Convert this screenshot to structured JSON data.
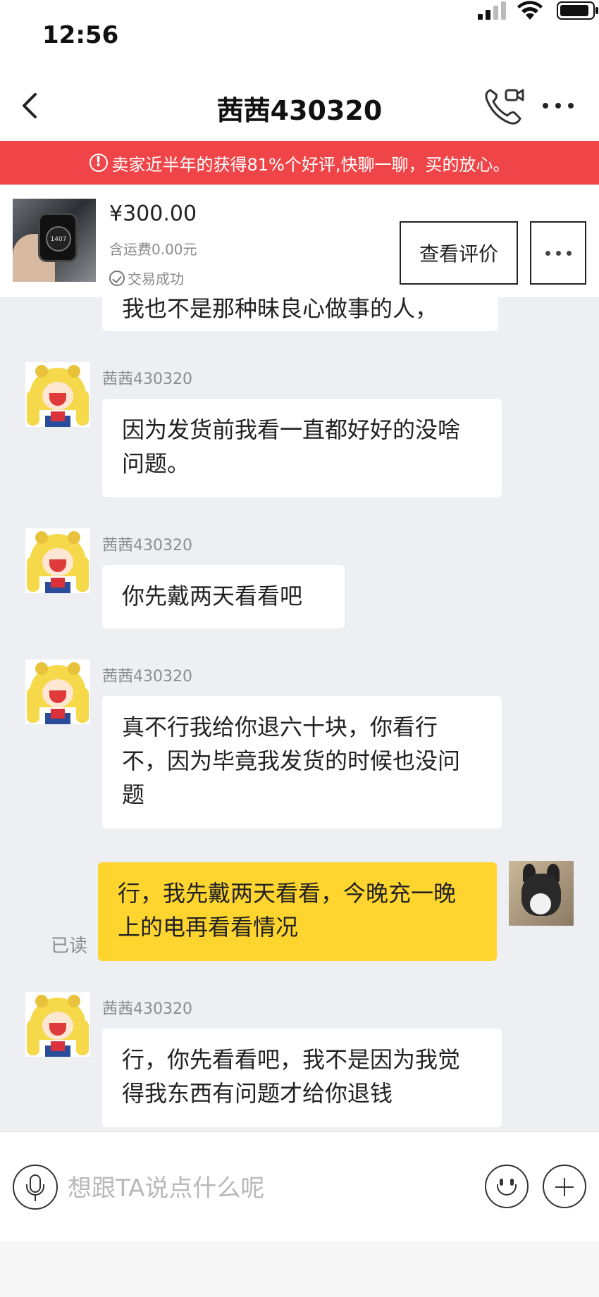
{
  "status_bar": {
    "time": "12:56"
  },
  "nav": {
    "title": "茜茜430320"
  },
  "banner": {
    "text": "卖家近半年的获得81%个好评,快聊一聊，买的放心。"
  },
  "product": {
    "price": "¥300.00",
    "shipping": "含运费0.00元",
    "status": "交易成功",
    "review_button": "查看评价",
    "watch_face": "1407"
  },
  "chat": {
    "partial_message": "我也不是那种昧良心做事的人，",
    "messages": [
      {
        "sender": "茜茜430320",
        "text": "因为发货前我看一直都好好的没啥问题。"
      },
      {
        "sender": "茜茜430320",
        "text": "你先戴两天看看吧"
      },
      {
        "sender": "茜茜430320",
        "text": "真不行我给你退六十块，你看行不，因为毕竟我发货的时候也没问题"
      },
      {
        "sender": "me",
        "text": "行，我先戴两天看看，今晚充一晚上的电再看看情况",
        "read_label": "已读"
      },
      {
        "sender": "茜茜430320",
        "text": "行，你先看看吧，我不是因为我觉得我东西有问题才给你退钱"
      }
    ]
  },
  "input": {
    "placeholder": "想跟TA说点什么呢"
  },
  "colors": {
    "banner": "#f04548",
    "my_bubble": "#fed42f",
    "background": "#eeeff3"
  }
}
